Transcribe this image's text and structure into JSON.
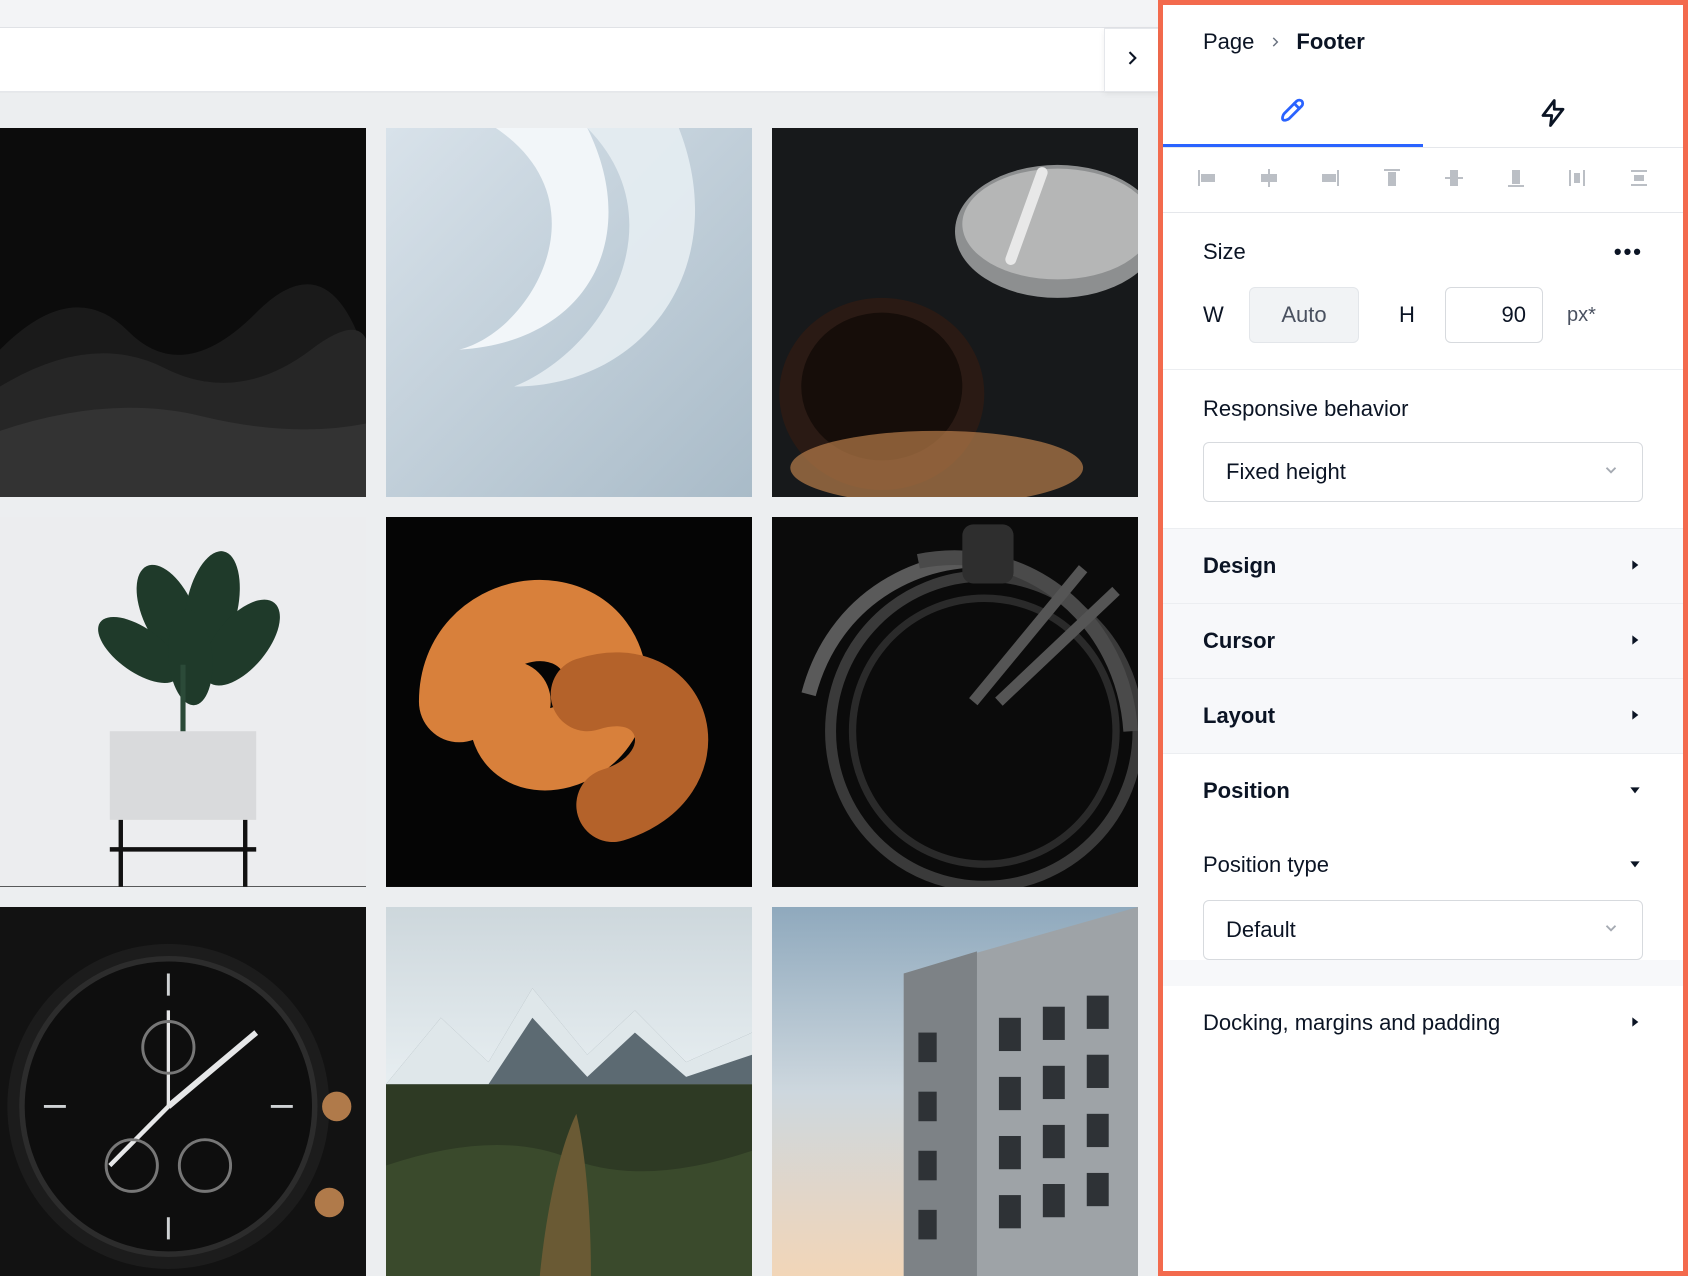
{
  "breadcrumb": {
    "parent": "Page",
    "current": "Footer"
  },
  "size": {
    "label": "Size",
    "more": "•••",
    "w_label": "W",
    "w_value": "Auto",
    "h_label": "H",
    "h_value": "90",
    "h_unit": "px*"
  },
  "responsive": {
    "label": "Responsive behavior",
    "value": "Fixed height"
  },
  "accordion": {
    "design": "Design",
    "cursor": "Cursor",
    "layout": "Layout",
    "position": "Position",
    "position_type": "Position type",
    "position_value": "Default",
    "docking": "Docking, margins and padding"
  }
}
